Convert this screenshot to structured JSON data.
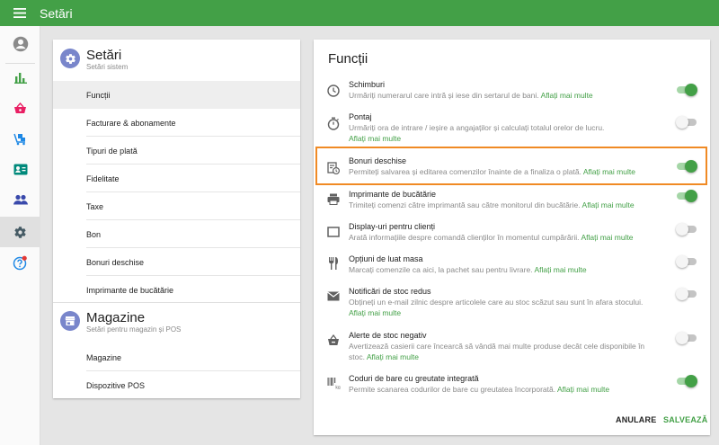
{
  "header": {
    "title": "Setări",
    "bar_color": "#43a047"
  },
  "rail": {
    "items": [
      {
        "icon": "account-circle-icon"
      },
      {
        "icon": "bar-chart-icon"
      },
      {
        "icon": "basket-icon"
      },
      {
        "icon": "items-cart-icon"
      },
      {
        "icon": "badge-card-icon"
      },
      {
        "icon": "people-icon"
      },
      {
        "icon": "settings-icon",
        "active": true
      },
      {
        "icon": "help-icon"
      }
    ]
  },
  "settings_nav": {
    "settings_section": {
      "title": "Setări",
      "subtitle": "Setări sistem",
      "items": [
        "Funcții",
        "Facturare & abonamente",
        "Tipuri de plată",
        "Fidelitate",
        "Taxe",
        "Bon",
        "Bonuri deschise",
        "Imprimante de bucătărie"
      ],
      "selected": "Funcții"
    },
    "stores_section": {
      "title": "Magazine",
      "subtitle": "Setări pentru magazin și POS",
      "items": [
        "Magazine",
        "Dispozitive POS"
      ]
    }
  },
  "features": {
    "title": "Funcții",
    "learn_more": "Aflați mai multe",
    "items": [
      {
        "icon": "clock-icon",
        "name": "Schimburi",
        "desc": "Urmăriți numerarul care intră și iese din sertarul de bani.",
        "enabled": true
      },
      {
        "icon": "stopwatch-icon",
        "name": "Pontaj",
        "desc": "Urmăriți ora de intrare / ieșire a angajaților și calculați totalul orelor de lucru.",
        "enabled": false
      },
      {
        "icon": "open-tickets-icon",
        "name": "Bonuri deschise",
        "desc": "Permiteți salvarea și editarea comenzilor înainte de a finaliza o plată.",
        "enabled": true,
        "highlighted": true
      },
      {
        "icon": "printer-icon",
        "name": "Imprimante de bucătărie",
        "desc": "Trimiteți comenzi către imprimantă sau către monitorul din bucătărie.",
        "enabled": true
      },
      {
        "icon": "display-icon",
        "name": "Display-uri pentru clienți",
        "desc": "Arată informațiile despre comandă clienților în momentul cumpărării.",
        "enabled": false
      },
      {
        "icon": "dining-icon",
        "name": "Opțiuni de luat masa",
        "desc": "Marcați comenzile ca aici, la pachet sau pentru livrare.",
        "enabled": false
      },
      {
        "icon": "mail-icon",
        "name": "Notificări de stoc redus",
        "desc": "Obțineți un e-mail zilnic despre articolele care au stoc scăzut sau sunt în afara stocului.",
        "enabled": false
      },
      {
        "icon": "negative-stock-icon",
        "name": "Alerte de stoc negativ",
        "desc": "Avertizează casierii care încearcă să vândă mai multe produse decât cele disponibile în stoc.",
        "enabled": false
      },
      {
        "icon": "barcode-weight-icon",
        "name": "Coduri de bare cu greutate integrată",
        "desc": "Permite scanarea codurilor de bare cu greutatea încorporată.",
        "enabled": true
      }
    ]
  },
  "actions": {
    "cancel": "ANULARE",
    "save": "SALVEAZĂ"
  },
  "colors": {
    "accent": "#43a047",
    "highlight": "#f08a24",
    "toggle_on": "#43a047",
    "toggle_off": "#f5f5f5"
  }
}
